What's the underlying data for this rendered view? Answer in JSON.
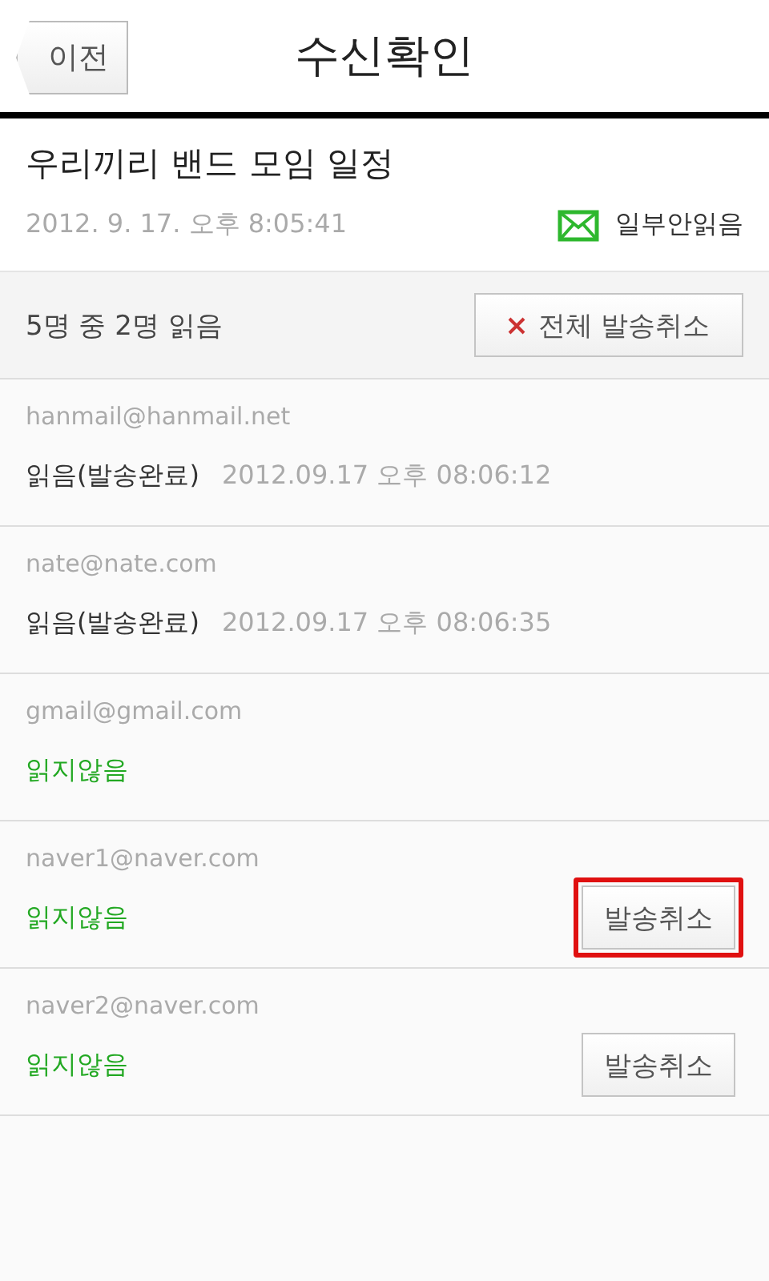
{
  "header": {
    "back_button": "이전",
    "title": "수신확인"
  },
  "message": {
    "subject": "우리끼리 밴드 모임 일정",
    "sent_time": "2012. 9. 17. 오후 8:05:41",
    "status": "일부안읽음"
  },
  "summary": {
    "text": "5명 중 2명 읽음",
    "cancel_all_button": "전체 발송취소"
  },
  "recipients": [
    {
      "email": "hanmail@hanmail.net",
      "kind": "read",
      "status": "읽음(발송완료)",
      "time": "2012.09.17 오후 08:06:12"
    },
    {
      "email": "nate@nate.com",
      "kind": "read",
      "status": "읽음(발송완료)",
      "time": "2012.09.17 오후 08:06:35"
    },
    {
      "email": "gmail@gmail.com",
      "kind": "unread",
      "status": "읽지않음"
    },
    {
      "email": "naver1@naver.com",
      "kind": "unread",
      "status": "읽지않음",
      "cancel_button": "발송취소",
      "highlighted": true
    },
    {
      "email": "naver2@naver.com",
      "kind": "unread",
      "status": "읽지않음",
      "cancel_button": "발송취소",
      "highlighted": false
    }
  ]
}
